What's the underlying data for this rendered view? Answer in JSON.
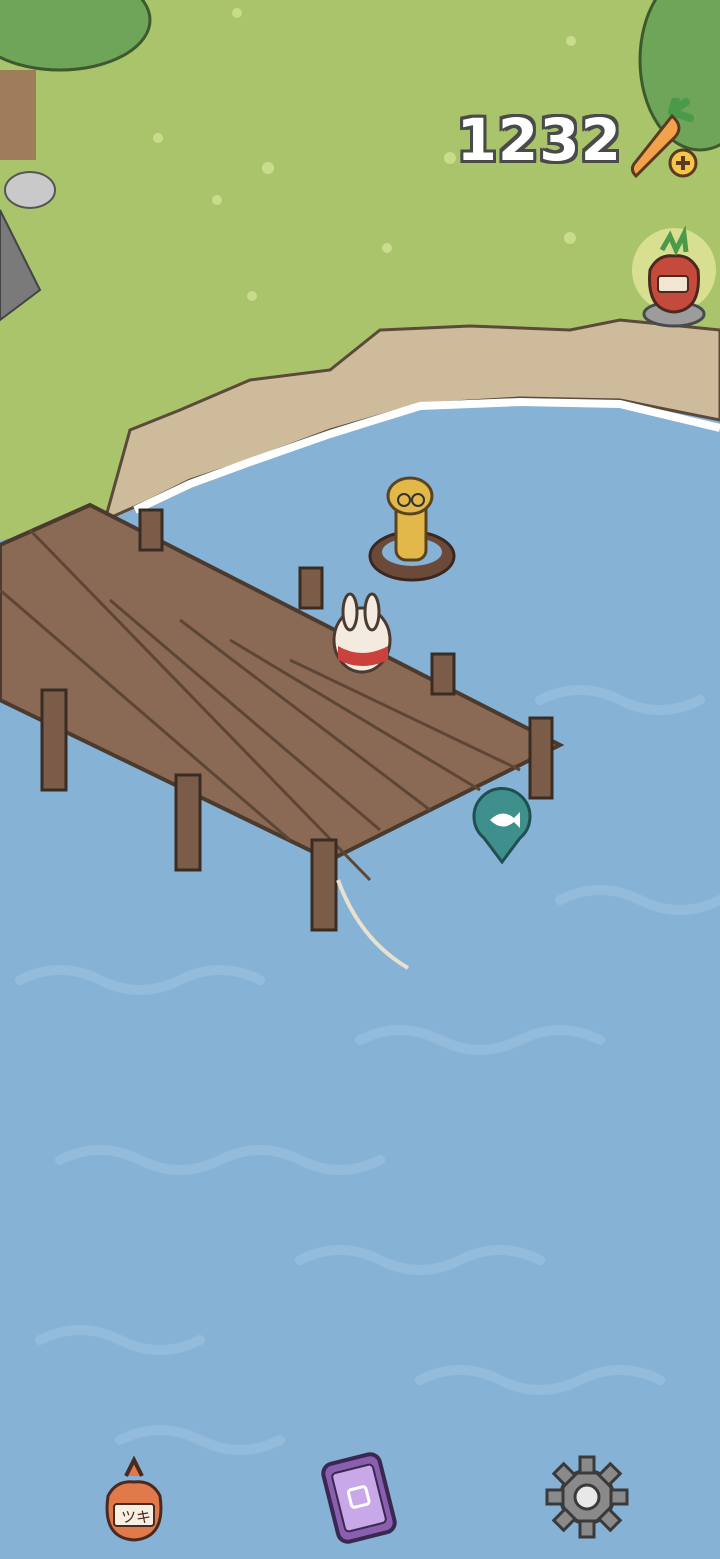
{
  "hud": {
    "carrot_count": "1232",
    "carrot_icon": "carrot-icon",
    "add_icon": "plus-icon"
  },
  "scene": {
    "gift_icon": "carrot-gift-bag-icon",
    "fishing_spot_icon": "fish-icon"
  },
  "bottom_bar": {
    "bag_label": "ツキ",
    "bag_icon": "bag-icon",
    "phone_icon": "phone-icon",
    "settings_icon": "gear-icon"
  },
  "colors": {
    "grass": "#a9c46a",
    "water": "#86b2d6",
    "dock_wood": "#8a6a55",
    "cliff": "#cdbb9c",
    "fish_marker": "#3f8f8c",
    "phone": "#8a5fb0"
  }
}
